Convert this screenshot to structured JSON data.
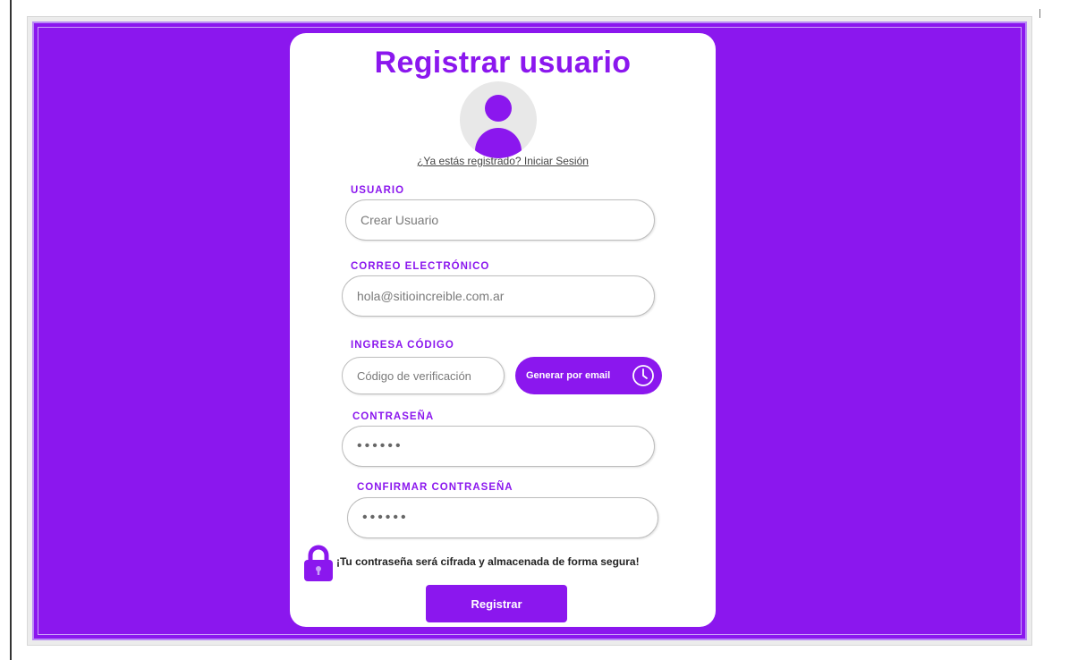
{
  "form": {
    "title": "Registrar usuario",
    "login_link": "¿Ya estás registrado? Iniciar Sesión",
    "username": {
      "label": "USUARIO",
      "placeholder": "Crear Usuario"
    },
    "email": {
      "label": "CORREO ELECTRÓNICO",
      "placeholder": "hola@sitioincreible.com.ar"
    },
    "code": {
      "label": "INGRESA CÓDIGO",
      "placeholder": "Código de verificación",
      "button": "Generar por email"
    },
    "password": {
      "label": "CONTRASEÑA",
      "value": "••••••"
    },
    "confirm_password": {
      "label": "CONFIRMAR CONTRASEÑA",
      "value": "••••••"
    },
    "security_notice": "¡Tu contraseña será cifrada y almacenada de forma segura!",
    "submit_label": "Registrar"
  },
  "icons": {
    "avatar": "user-avatar-icon",
    "clock": "clock-icon",
    "lock": "lock-icon"
  },
  "colors": {
    "accent": "#8b17ee",
    "card": "#ffffff"
  }
}
